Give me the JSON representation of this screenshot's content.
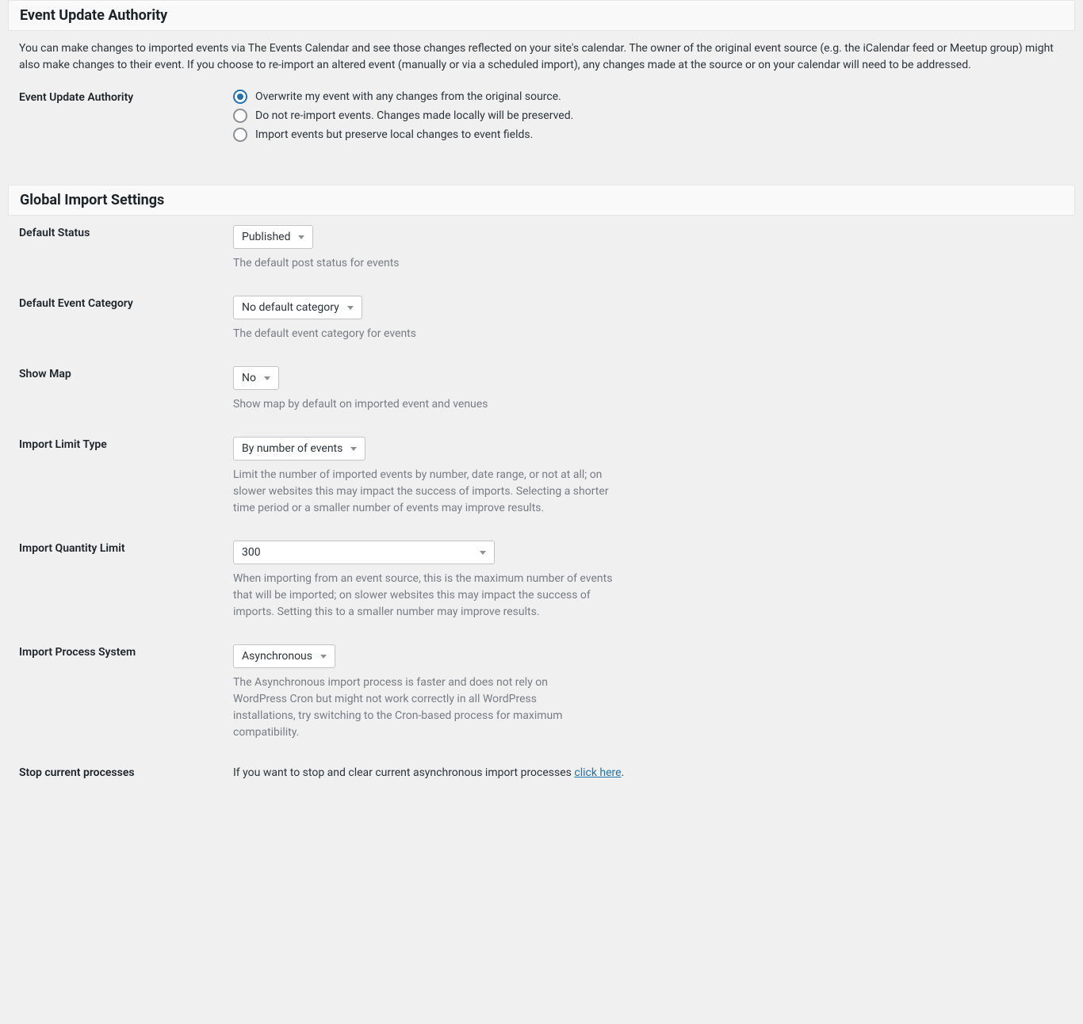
{
  "section1": {
    "title": "Event Update Authority",
    "description": "You can make changes to imported events via The Events Calendar and see those changes reflected on your site's calendar. The owner of the original event source (e.g. the iCalendar feed or Meetup group) might also make changes to their event. If you choose to re-import an altered event (manually or via a scheduled import), any changes made at the source or on your calendar will need to be addressed.",
    "fieldLabel": "Event Update Authority",
    "radios": {
      "option1": "Overwrite my event with any changes from the original source.",
      "option2": "Do not re-import events. Changes made locally will be preserved.",
      "option3": "Import events but preserve local changes to event fields."
    }
  },
  "section2": {
    "title": "Global Import Settings",
    "defaultStatus": {
      "label": "Default Status",
      "value": "Published",
      "help": "The default post status for events"
    },
    "defaultCategory": {
      "label": "Default Event Category",
      "value": "No default category",
      "help": "The default event category for events"
    },
    "showMap": {
      "label": "Show Map",
      "value": "No",
      "help": "Show map by default on imported event and venues"
    },
    "importLimitType": {
      "label": "Import Limit Type",
      "value": "By number of events",
      "help": "Limit the number of imported events by number, date range, or not at all; on slower websites this may impact the success of imports. Selecting a shorter time period or a smaller number of events may improve results."
    },
    "importQuantity": {
      "label": "Import Quantity Limit",
      "value": "300",
      "help": "When importing from an event source, this is the maximum number of events that will be imported; on slower websites this may impact the success of imports. Setting this to a smaller number may improve results."
    },
    "importProcess": {
      "label": "Import Process System",
      "value": "Asynchronous",
      "help": "The Asynchronous import process is faster and does not rely on WordPress Cron but might not work correctly in all WordPress installations, try switching to the Cron-based process for maximum compatibility."
    },
    "stopProcesses": {
      "label": "Stop current processes",
      "textBefore": "If you want to stop and clear current asynchronous import processes ",
      "linkText": "click here",
      "textAfter": "."
    }
  }
}
